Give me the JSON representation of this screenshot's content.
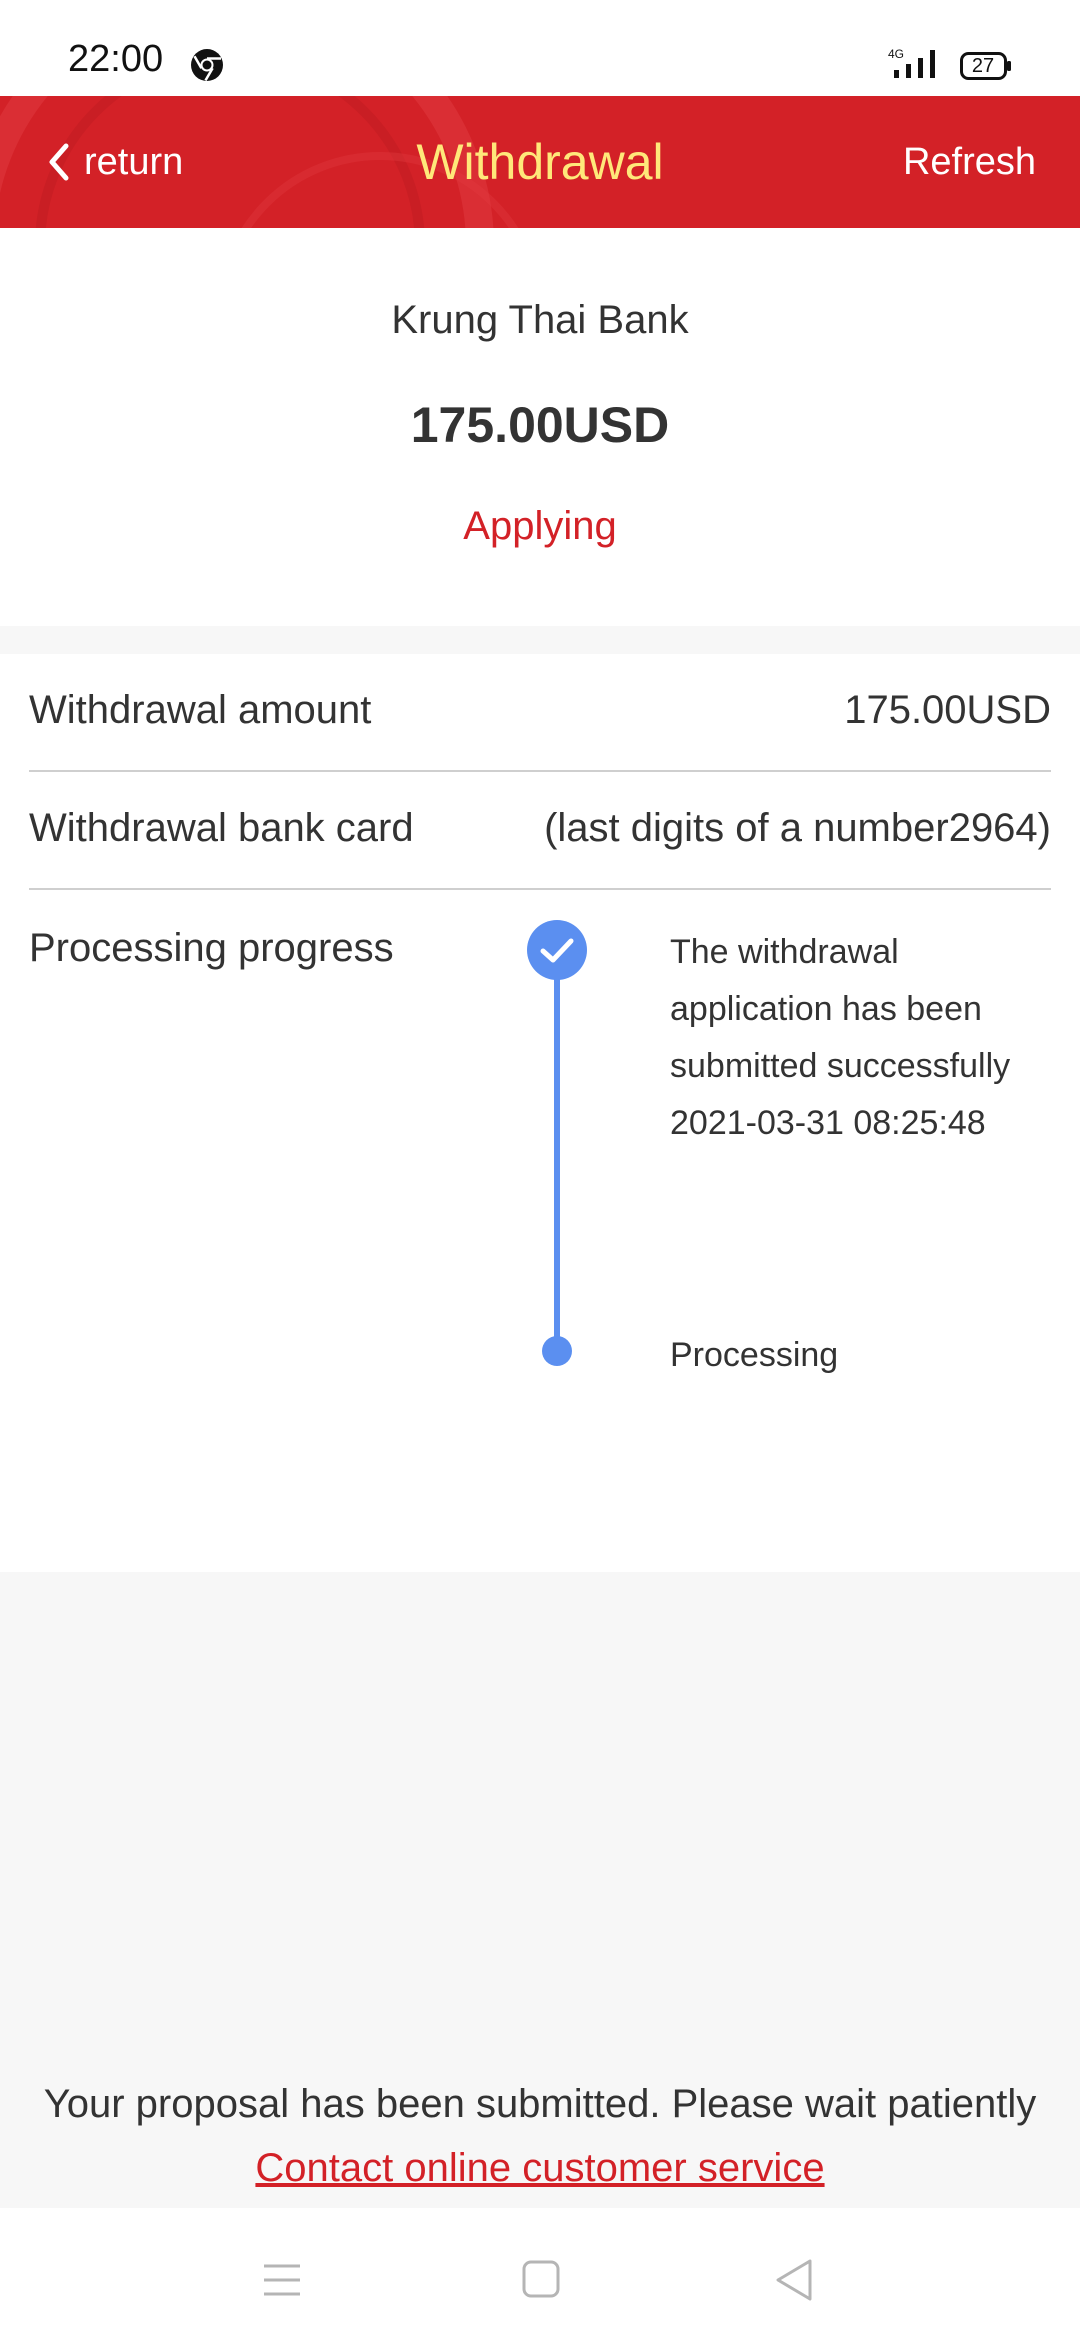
{
  "status_bar": {
    "time": "22:00",
    "network": "4G",
    "battery": "27"
  },
  "header": {
    "back_label": "return",
    "title": "Withdrawal",
    "refresh_label": "Refresh"
  },
  "summary": {
    "bank_name": "Krung Thai Bank",
    "amount": "175.00USD",
    "status": "Applying"
  },
  "details": {
    "amount_label": "Withdrawal amount",
    "amount_value": "175.00USD",
    "card_label": "Withdrawal bank card",
    "card_value": "(last digits of a number2964)",
    "progress_label": "Processing progress",
    "steps": [
      {
        "text": "The withdrawal application has been submitted successfully",
        "time": "2021-03-31 08:25:48"
      },
      {
        "text": "Processing"
      }
    ]
  },
  "footer": {
    "note": "Your proposal has been submitted. Please wait patiently",
    "contact_link": "Contact online customer service"
  },
  "colors": {
    "header_bg": "#d32127",
    "title": "#ffe87a",
    "accent_red": "#d32127",
    "timeline_blue": "#5b8ff0"
  }
}
